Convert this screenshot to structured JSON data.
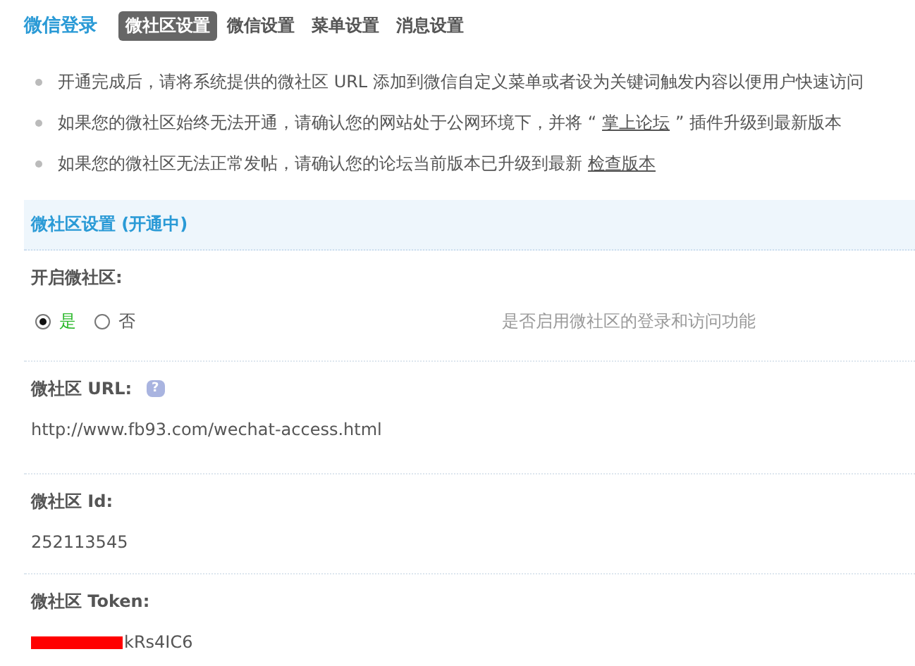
{
  "title": "微信登录",
  "tabs": [
    {
      "label": "微社区设置",
      "selected": true
    },
    {
      "label": "微信设置",
      "selected": false
    },
    {
      "label": "菜单设置",
      "selected": false
    },
    {
      "label": "消息设置",
      "selected": false
    }
  ],
  "tips": [
    {
      "text": "开通完成后，请将系统提供的微社区 URL 添加到微信自定义菜单或者设为关键词触发内容以便用户快速访问"
    },
    {
      "text": "如果您的微社区始终无法开通，请确认您的网站处于公网环境下，并将 “",
      "link": "掌上论坛",
      "after": "” 插件升级到最新版本"
    },
    {
      "text": "如果您的微社区无法正常发帖，请确认您的论坛当前版本已升级到最新",
      "link": "检查版本"
    }
  ],
  "section": {
    "title": "微社区设置 (开通中)"
  },
  "fields": [
    {
      "kind": "radio",
      "label": "开启微社区:",
      "options": [
        {
          "label": "是",
          "selected": true
        },
        {
          "label": "否",
          "selected": false
        }
      ],
      "hint": "是否启用微社区的登录和访问功能"
    },
    {
      "kind": "text",
      "label": "微社区 URL:",
      "help": "?",
      "value": "http://www.fb93.com/wechat-access.html"
    },
    {
      "kind": "text",
      "label": "微社区 Id:",
      "value": "252113545"
    },
    {
      "kind": "text",
      "label": "微社区 Token:",
      "redacted": true,
      "value": "kRs4IC6"
    }
  ]
}
